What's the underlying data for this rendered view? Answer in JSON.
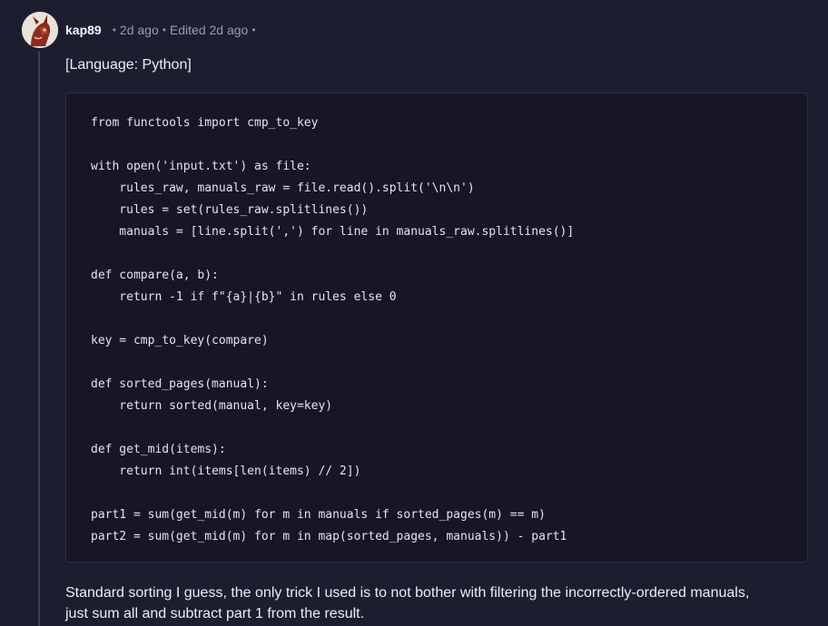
{
  "post": {
    "username": "kap89",
    "posted": "2d ago",
    "edited": "Edited 2d ago",
    "language_tag": "[Language: Python]",
    "code_lines": [
      "from functools import cmp_to_key",
      "",
      "with open('input.txt') as file:",
      "    rules_raw, manuals_raw = file.read().split('\\n\\n')",
      "    rules = set(rules_raw.splitlines())",
      "    manuals = [line.split(',') for line in manuals_raw.splitlines()]",
      "",
      "def compare(a, b):",
      "    return -1 if f\"{a}|{b}\" in rules else 0",
      "",
      "key = cmp_to_key(compare)",
      "",
      "def sorted_pages(manual):",
      "    return sorted(manual, key=key)",
      "",
      "def get_mid(items):",
      "    return int(items[len(items) // 2])",
      "",
      "part1 = sum(get_mid(m) for m in manuals if sorted_pages(m) == m)",
      "part2 = sum(get_mid(m) for m in map(sorted_pages, manuals)) - part1"
    ],
    "summary_line1": "Standard sorting I guess, the only trick I used is to not bother with filtering the incorrectly-ordered manuals,",
    "summary_line2": "just sum all and subtract part 1 from the result."
  },
  "icons": {
    "avatar": "dragon-avatar-icon"
  },
  "colors": {
    "background": "#1d1d30",
    "code_background": "#161627",
    "meta_text": "#9a9ab0"
  }
}
